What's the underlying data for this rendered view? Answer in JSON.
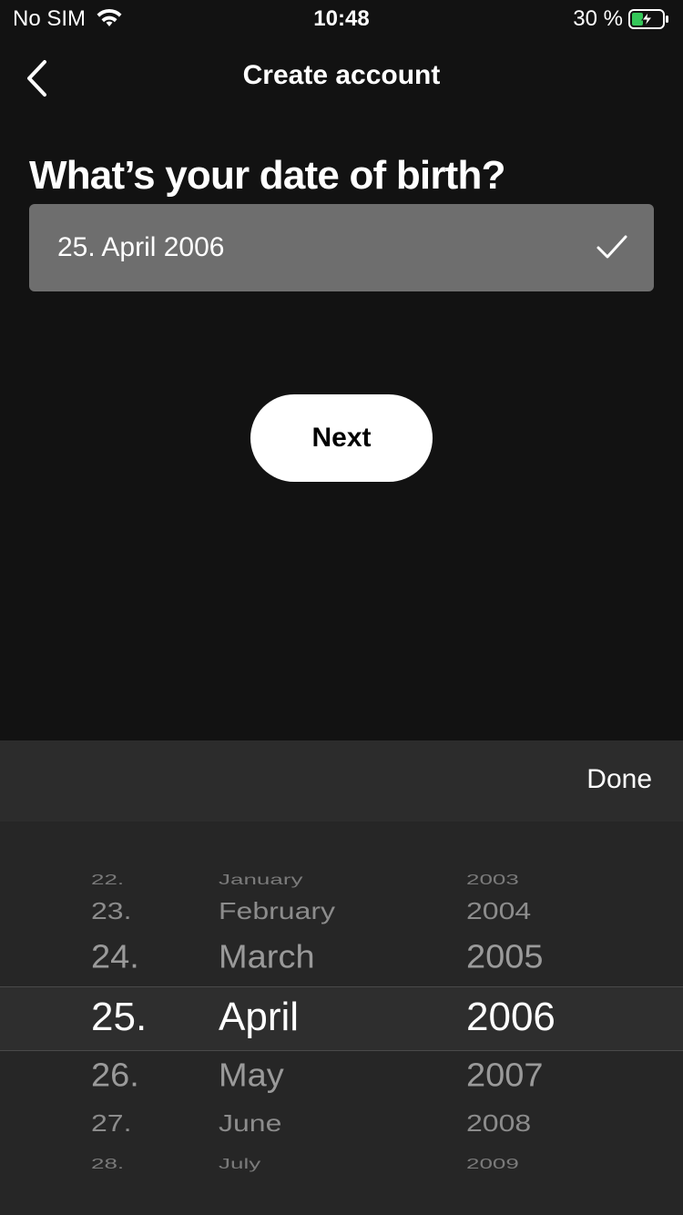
{
  "status_bar": {
    "carrier": "No SIM",
    "time": "10:48",
    "battery_percent": "30 %",
    "wifi_icon": "wifi-icon",
    "battery_icon": "battery-charging-icon",
    "battery_color": "#34c759"
  },
  "nav": {
    "back_icon": "chevron-left-icon",
    "title": "Create account"
  },
  "form": {
    "question": "What’s your date of birth?",
    "date_value": "25. April 2006",
    "check_icon": "checkmark-icon"
  },
  "next_label": "Next",
  "picker": {
    "done_label": "Done",
    "days": [
      "22.",
      "23.",
      "24.",
      "25.",
      "26.",
      "27.",
      "28."
    ],
    "months": [
      "January",
      "February",
      "March",
      "April",
      "May",
      "June",
      "July"
    ],
    "years": [
      "2003",
      "2004",
      "2005",
      "2006",
      "2007",
      "2008",
      "2009"
    ],
    "selected_index": 3
  },
  "colors": {
    "background": "#121212",
    "field": "#6e6e6e",
    "picker_bg": "#262626",
    "toolbar_bg": "#2c2c2c"
  }
}
